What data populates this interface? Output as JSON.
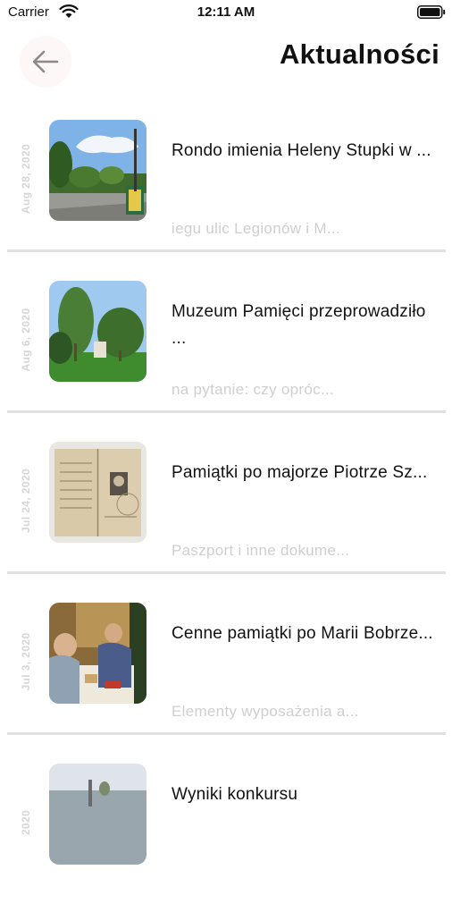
{
  "status_bar": {
    "carrier": "Carrier",
    "time": "12:11 AM"
  },
  "header": {
    "back_icon": "arrow-left-icon",
    "title": "Aktualności"
  },
  "news": [
    {
      "date": "Aug 28, 2020",
      "title": "Rondo imienia Heleny Stupki w ...",
      "excerpt": "iegu ulic Legionów i M..."
    },
    {
      "date": "Aug 6, 2020",
      "title": "Muzeum Pamięci przeprowadziło ...",
      "excerpt": "na pytanie: czy opróc..."
    },
    {
      "date": "Jul 24, 2020",
      "title": "Pamiątki po majorze Piotrze Sz...",
      "excerpt": "Paszport i inne dokume..."
    },
    {
      "date": "Jul 3, 2020",
      "title": "Cenne pamiątki po Marii Bobrze...",
      "excerpt": "Elementy wyposażenia a..."
    },
    {
      "date": "2020",
      "title": "Wyniki konkursu",
      "excerpt": ""
    }
  ],
  "colors": {
    "date": "#d6d6d6",
    "excerpt": "#cfcfcf",
    "divider": "#e0e0e0",
    "back_button_bg": "#fdf7f7"
  }
}
